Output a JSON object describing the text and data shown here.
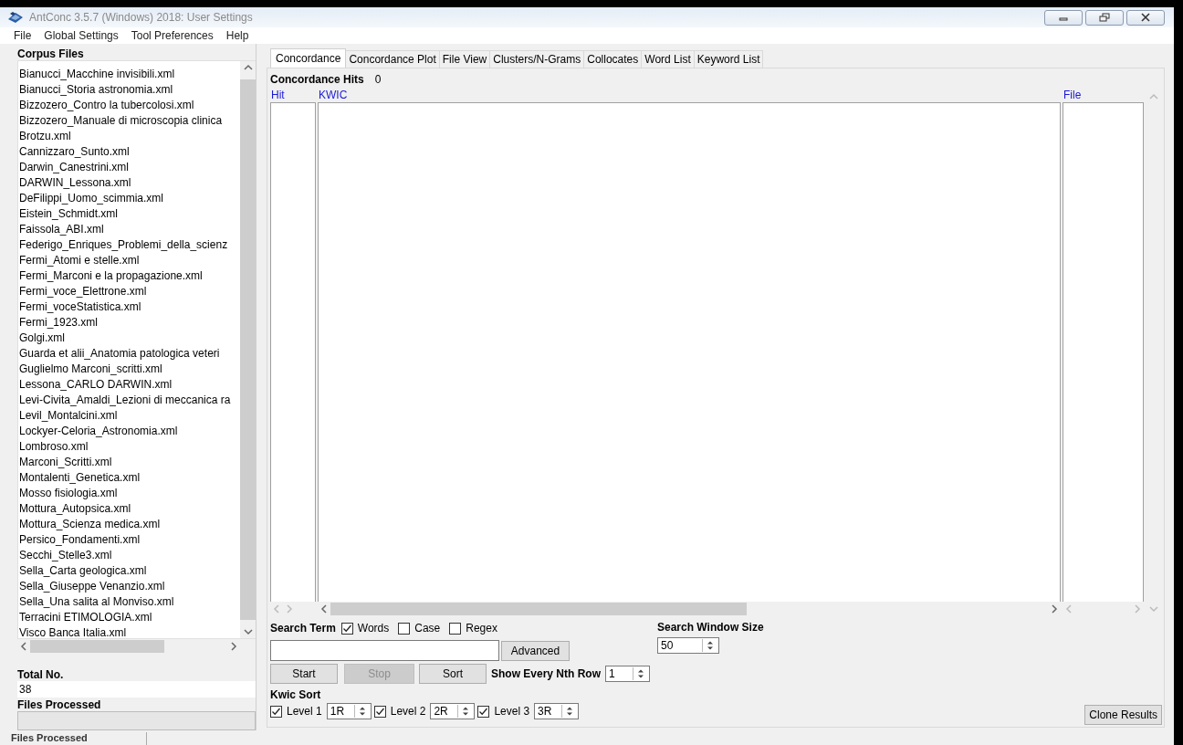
{
  "window": {
    "title": "AntConc 3.5.7 (Windows) 2018: User Settings"
  },
  "menu": [
    "File",
    "Global Settings",
    "Tool Preferences",
    "Help"
  ],
  "corpus_files": {
    "heading": "Corpus Files",
    "items": [
      "Bianucci_Macchine invisibili.xml",
      "Bianucci_Storia astronomia.xml",
      "Bizzozero_Contro la tubercolosi.xml",
      "Bizzozero_Manuale di microscopia clinica",
      "Brotzu.xml",
      "Cannizzaro_Sunto.xml",
      "Darwin_Canestrini.xml",
      "DARWIN_Lessona.xml",
      "DeFilippi_Uomo_scimmia.xml",
      "Eistein_Schmidt.xml",
      "Faissola_ABI.xml",
      "Federigo_Enriques_Problemi_della_scienz",
      "Fermi_Atomi e stelle.xml",
      "Fermi_Marconi e la propagazione.xml",
      "Fermi_voce_Elettrone.xml",
      "Fermi_voceStatistica.xml",
      "Fermi_1923.xml",
      "Golgi.xml",
      "Guarda et alii_Anatomia patologica veteri",
      "Guglielmo Marconi_scritti.xml",
      "Lessona_CARLO DARWIN.xml",
      "Levi-Civita_Amaldi_Lezioni di meccanica ra",
      "Levil_Montalcini.xml",
      "Lockyer-Celoria_Astronomia.xml",
      "Lombroso.xml",
      "Marconi_Scritti.xml",
      "Montalenti_Genetica.xml",
      "Mosso fisiologia.xml",
      "Mottura_Autopsica.xml",
      "Mottura_Scienza medica.xml",
      "Persico_Fondamenti.xml",
      "Secchi_Stelle3.xml",
      "Sella_Carta geologica.xml",
      "Sella_Giuseppe Venanzio.xml",
      "Sella_Una salita al Monviso.xml",
      "Terracini ETIMOLOGIA.xml",
      "Visco Banca Italia.xml"
    ]
  },
  "total_no": {
    "label": "Total No.",
    "value": "38"
  },
  "files_processed": {
    "label": "Files Processed",
    "level": 0
  },
  "tabs": [
    {
      "label": "Concordance",
      "selected": true
    },
    {
      "label": "Concordance Plot",
      "selected": false
    },
    {
      "label": "File View",
      "selected": false
    },
    {
      "label": "Clusters/N-Grams",
      "selected": false
    },
    {
      "label": "Collocates",
      "selected": false
    },
    {
      "label": "Word List",
      "selected": false
    },
    {
      "label": "Keyword List",
      "selected": false
    }
  ],
  "hits": {
    "label": "Concordance Hits",
    "value": "0"
  },
  "columns": [
    "Hit",
    "KWIC",
    "File"
  ],
  "search": {
    "label": "Search Term",
    "options": [
      {
        "label": "Words",
        "checked": true
      },
      {
        "label": "Case",
        "checked": false
      },
      {
        "label": "Regex",
        "checked": false
      }
    ]
  },
  "advanced_button": "Advanced",
  "actions": [
    {
      "label": "Start",
      "disabled": false
    },
    {
      "label": "Stop",
      "disabled": true
    },
    {
      "label": "Sort",
      "disabled": false
    }
  ],
  "nth_row": {
    "label": "Show Every Nth Row",
    "value": "1"
  },
  "window_size": {
    "label": "Search Window Size",
    "value": "50"
  },
  "kwic_sort": {
    "label": "Kwic Sort",
    "levels": [
      {
        "label": "Level 1",
        "checked": true,
        "value": "1R"
      },
      {
        "label": "Level 2",
        "checked": true,
        "value": "2R"
      },
      {
        "label": "Level 3",
        "checked": true,
        "value": "3R"
      }
    ]
  },
  "clone_button": "Clone Results",
  "background_window": {
    "label": "Files Processed"
  }
}
